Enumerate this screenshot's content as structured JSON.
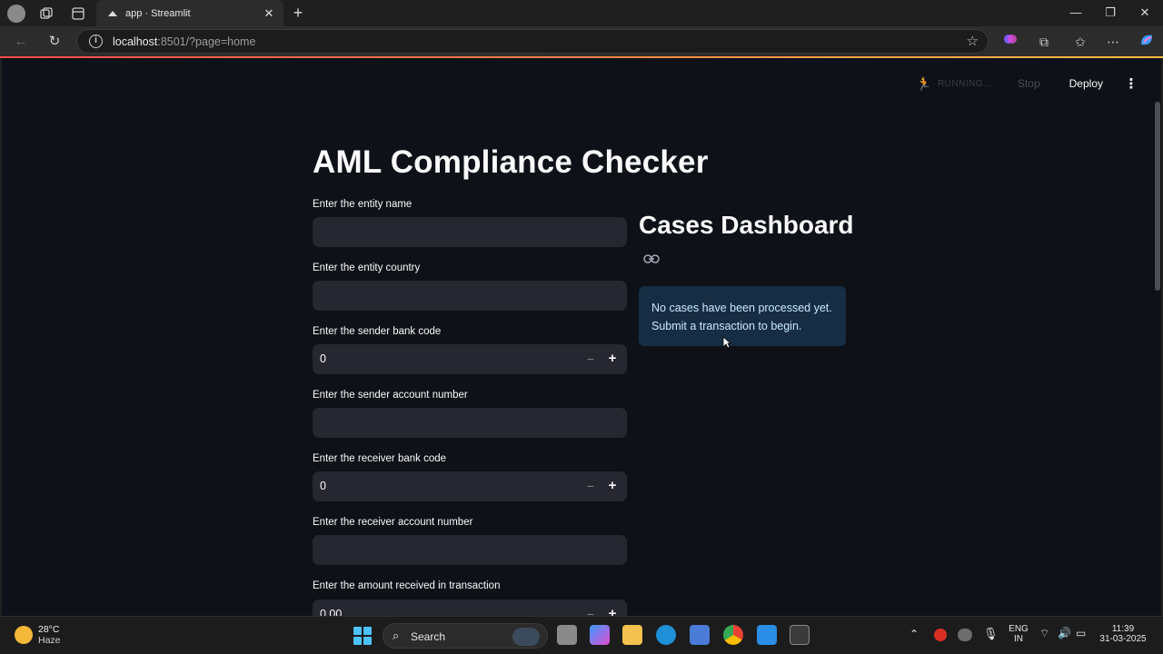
{
  "browser": {
    "tab_title": "app · Streamlit",
    "url_host": "localhost",
    "url_rest": ":8501/?page=home"
  },
  "header": {
    "running_label": "RUNNING...",
    "stop_label": "Stop",
    "deploy_label": "Deploy"
  },
  "app": {
    "title": "AML Compliance Checker",
    "fields": [
      {
        "label": "Enter the entity name",
        "type": "text",
        "value": ""
      },
      {
        "label": "Enter the entity country",
        "type": "text",
        "value": ""
      },
      {
        "label": "Enter the sender bank code",
        "type": "number",
        "value": "0"
      },
      {
        "label": "Enter the sender account number",
        "type": "text",
        "value": ""
      },
      {
        "label": "Enter the receiver bank code",
        "type": "number",
        "value": "0"
      },
      {
        "label": "Enter the receiver account number",
        "type": "text",
        "value": ""
      },
      {
        "label": "Enter the amount received in transaction",
        "type": "number",
        "value": "0.00"
      }
    ],
    "dashboard": {
      "title": "Cases Dashboard",
      "info_line1": "No cases have been processed yet.",
      "info_line2": "Submit a transaction to begin."
    }
  },
  "taskbar": {
    "temperature": "28°C",
    "weather": "Haze",
    "search_label": "Search",
    "lang1": "ENG",
    "lang2": "IN",
    "time": "11:39",
    "date": "31-03-2025"
  },
  "colors": {
    "app_bg": "#0e1117",
    "input_bg": "#262730",
    "info_bg": "#172d43",
    "info_text": "#c7ebff",
    "accent_start": "#ff4b4b",
    "accent_end": "#ffbd45"
  },
  "icons": [
    "profile-icon",
    "workspaces-icon",
    "tab-actions-icon",
    "streamlit-favicon",
    "close-icon",
    "new-tab-icon",
    "minimize-icon",
    "maximize-icon",
    "window-close-icon",
    "back-icon",
    "reload-icon",
    "site-info-icon",
    "favorite-star-icon",
    "copilot-icon",
    "extensions-icon",
    "favorites-icon",
    "more-icon",
    "link-icon",
    "kebab-menu-icon",
    "running-man-icon"
  ]
}
